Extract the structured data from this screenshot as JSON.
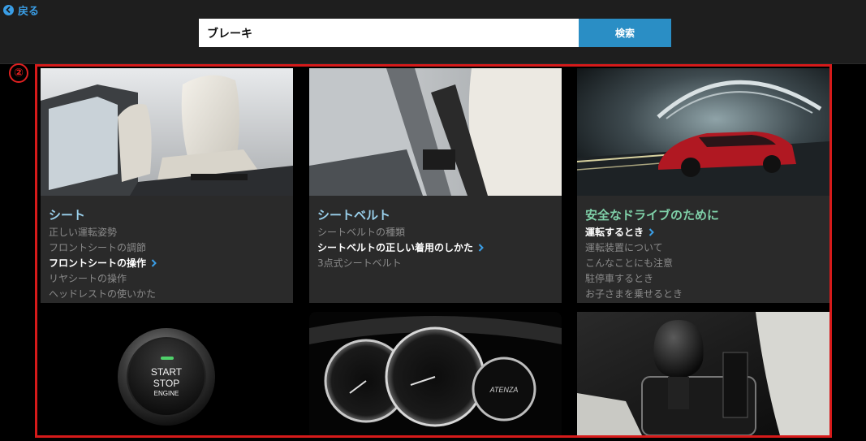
{
  "header": {
    "back_label": "戻る",
    "search_value": "ブレーキ",
    "search_button_label": "検索"
  },
  "annotation": {
    "marker": "②"
  },
  "colors": {
    "accent_blue": "#2a8ec5",
    "link_blue": "#3a9ee6",
    "frame_red": "#d61a1a",
    "title_blue": "#9ad0ec",
    "title_green": "#7fd0a8"
  },
  "cards": [
    {
      "title": "シート",
      "image_icon": "seat-image",
      "links": [
        {
          "label": "正しい運転姿勢",
          "active": false
        },
        {
          "label": "フロントシートの調節",
          "active": false
        },
        {
          "label": "フロントシートの操作",
          "active": true
        },
        {
          "label": "リヤシートの操作",
          "active": false
        },
        {
          "label": "ヘッドレストの使いかた",
          "active": false
        }
      ]
    },
    {
      "title": "シートベルト",
      "image_icon": "seatbelt-image",
      "links": [
        {
          "label": "シートベルトの種類",
          "active": false
        },
        {
          "label": "シートベルトの正しい着用のしかた",
          "active": true
        },
        {
          "label": "3点式シートベルト",
          "active": false
        }
      ]
    },
    {
      "title": "安全なドライブのために",
      "image_icon": "car-image",
      "links": [
        {
          "label": "運転するとき",
          "active": true
        },
        {
          "label": "運転装置について",
          "active": false
        },
        {
          "label": "こんなことにも注意",
          "active": false
        },
        {
          "label": "駐停車するとき",
          "active": false
        },
        {
          "label": "お子さまを乗せるとき",
          "active": false
        }
      ]
    }
  ],
  "tiles": [
    {
      "image_icon": "start-stop-button-image",
      "line1": "START",
      "line2": "STOP",
      "line3": "ENGINE"
    },
    {
      "image_icon": "gauge-cluster-image",
      "badge": "ATENZA"
    },
    {
      "image_icon": "shift-lever-image"
    }
  ]
}
